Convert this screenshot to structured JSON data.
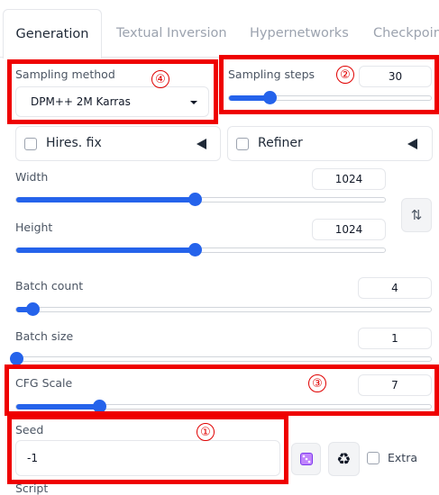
{
  "tabs": [
    {
      "label": "Generation",
      "active": true
    },
    {
      "label": "Textual Inversion",
      "active": false
    },
    {
      "label": "Hypernetworks",
      "active": false
    },
    {
      "label": "Checkpoints",
      "active": false
    }
  ],
  "sampling_method": {
    "label": "Sampling method",
    "value": "DPM++ 2M Karras",
    "annotation": "④"
  },
  "sampling_steps": {
    "label": "Sampling steps",
    "value": "30",
    "fraction": 0.2,
    "annotation": "②"
  },
  "hires_fix": {
    "label": "Hires. fix",
    "checked": false
  },
  "refiner": {
    "label": "Refiner",
    "checked": false
  },
  "width": {
    "label": "Width",
    "value": "1024",
    "fraction": 0.485
  },
  "height": {
    "label": "Height",
    "value": "1024",
    "fraction": 0.485
  },
  "swap_button": {
    "icon": "swap-vertical-icon",
    "glyph": "⇅"
  },
  "batch_count": {
    "label": "Batch count",
    "value": "4",
    "fraction": 0.04
  },
  "batch_size": {
    "label": "Batch size",
    "value": "1",
    "fraction": 0.0
  },
  "cfg_scale": {
    "label": "CFG Scale",
    "value": "7",
    "fraction": 0.2,
    "annotation": "③"
  },
  "seed": {
    "label": "Seed",
    "value": "-1",
    "annotation": "①"
  },
  "seed_buttons": {
    "random_icon": "dice-icon",
    "reuse_icon": "recycle-icon",
    "recycle_glyph": "♻",
    "extra_label": "Extra"
  },
  "bottom_partial_label": "Script",
  "colors": {
    "accent": "#2563eb",
    "annotation_red": "#ef0000"
  }
}
